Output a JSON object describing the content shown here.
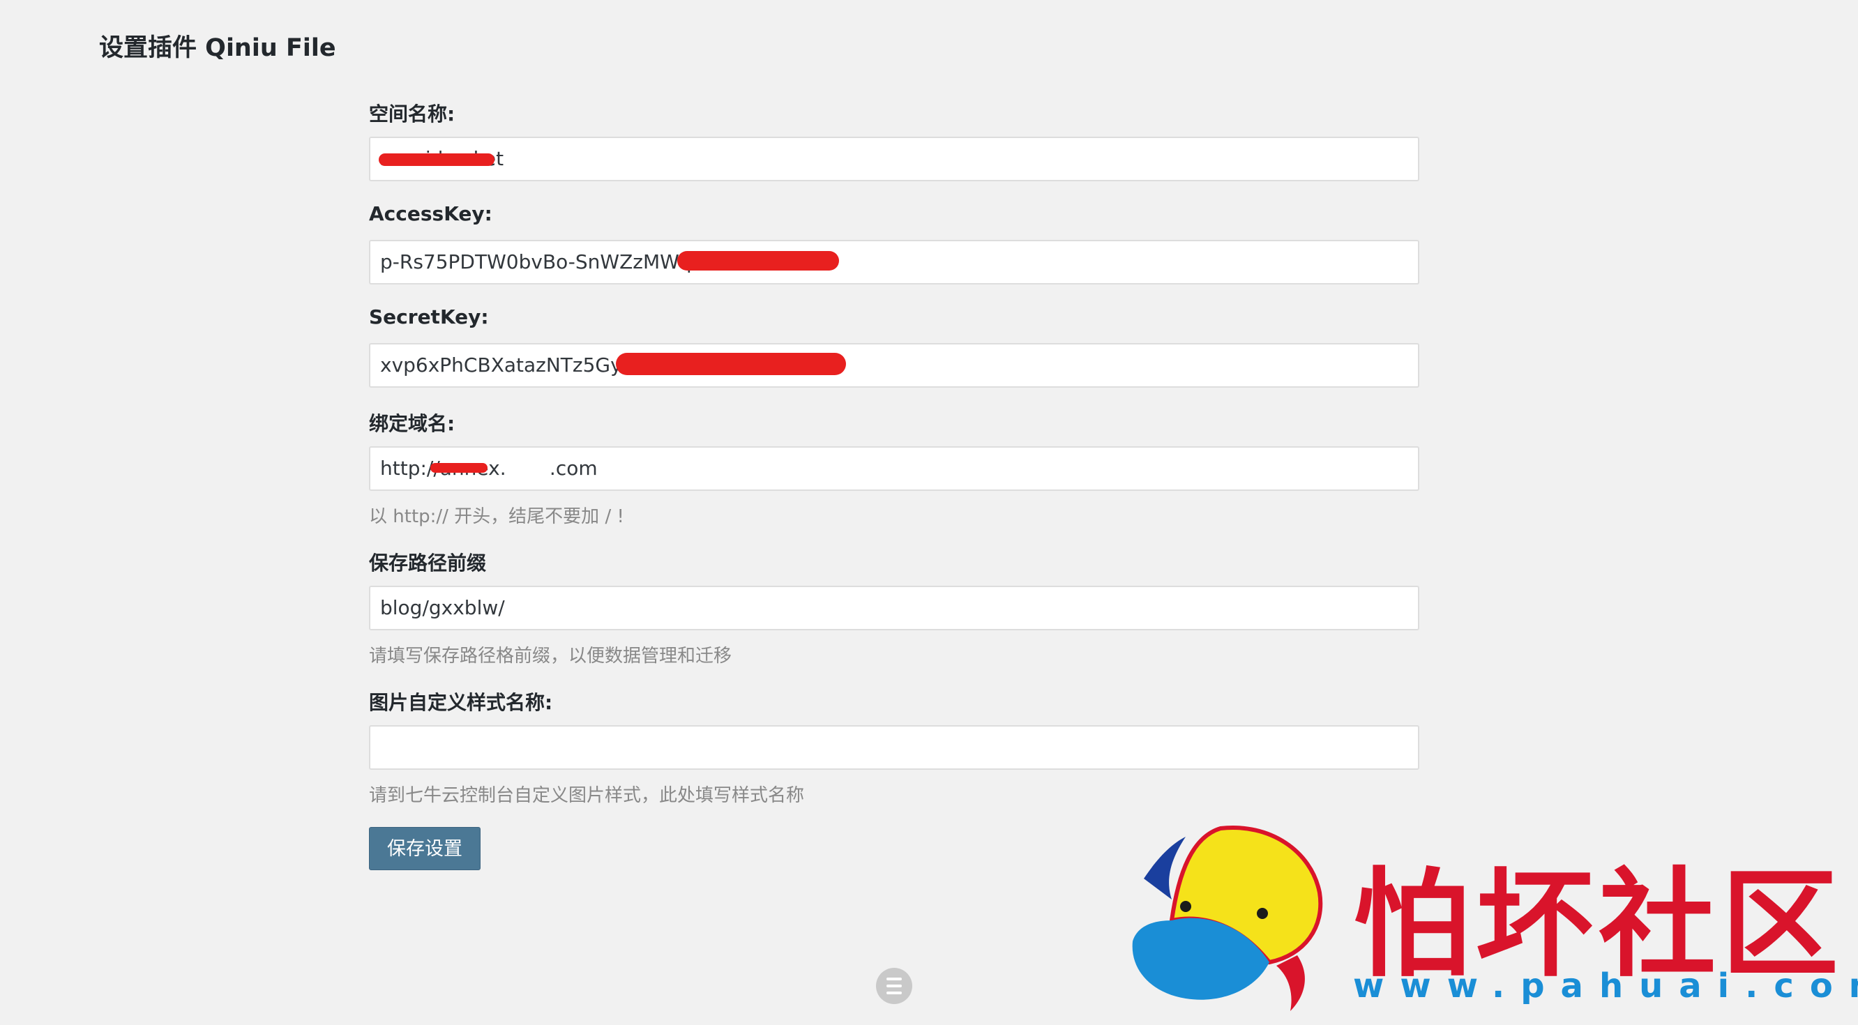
{
  "page": {
    "title": "设置插件 Qiniu File"
  },
  "form": {
    "bucket": {
      "label": "空间名称:",
      "value": "sucai-bucket"
    },
    "access_key": {
      "label": "AccessKey:",
      "value": "p-Rs75PDTW0bvBo-SnWZzMWql"
    },
    "secret_key": {
      "label": "SecretKey:",
      "value": "xvp6xPhCBXatazNTz5GyW"
    },
    "domain": {
      "label": "绑定域名:",
      "value": "http://annex.       .com",
      "hint": "以 http:// 开头，结尾不要加 / !"
    },
    "path_prefix": {
      "label": "保存路径前缀",
      "value": "blog/gxxblw/",
      "hint": "请填写保存路径格前缀，以便数据管理和迁移"
    },
    "image_style": {
      "label": "图片自定义样式名称:",
      "value": "",
      "hint": "请到七牛云控制台自定义图片样式，此处填写样式名称"
    },
    "save_label": "保存设置"
  },
  "watermark": {
    "text": "怕坏社区",
    "url": "www.pahuai.com"
  },
  "colors": {
    "background": "#f1f1f1",
    "button": "#4b7895",
    "redaction": "#e8201f",
    "watermark_red": "#d9142b",
    "watermark_blue": "#1a8ed6"
  }
}
